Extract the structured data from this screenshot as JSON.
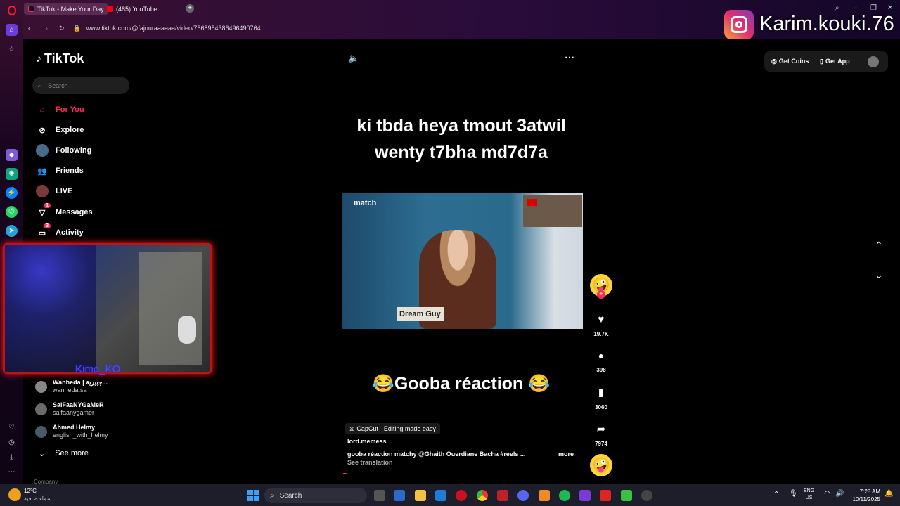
{
  "browser": {
    "tabs": [
      {
        "label": "TikTok - Make Your Day"
      },
      {
        "label": "(485) YouTube"
      }
    ],
    "url": "www.tiktok.com/@fajouraaaaaa/video/7568954386496490764"
  },
  "overlay": {
    "instagram_handle": "Karim.kouki.76",
    "webcam_name": "Kimo_KO"
  },
  "tiktok": {
    "logo": "TikTok",
    "search_placeholder": "Search",
    "nav": [
      {
        "label": "For You",
        "icon": "home-icon",
        "active": true
      },
      {
        "label": "Explore",
        "icon": "compass-icon"
      },
      {
        "label": "Following",
        "icon": "following-avatar"
      },
      {
        "label": "Friends",
        "icon": "friends-icon"
      },
      {
        "label": "LIVE",
        "icon": "live-avatar"
      },
      {
        "label": "Messages",
        "icon": "send-icon",
        "badge": "1"
      },
      {
        "label": "Activity",
        "icon": "chat-icon",
        "badge": "3"
      }
    ],
    "accounts": [
      {
        "name": "Wanheda | جبيرية...",
        "handle": "wanheda.sa"
      },
      {
        "name": "SalFaaNYGaMeR",
        "handle": "saifaanygamer"
      },
      {
        "name": "Ahmed Helmy",
        "handle": "english_with_helmy"
      }
    ],
    "see_more": "See more",
    "company": "Company",
    "header_buttons": {
      "coins": "Get Coins",
      "app": "Get App"
    },
    "video": {
      "caption_top": "ki tbda heya tmout 3atwil wenty t7bha md7d7a",
      "watermark": "match",
      "lower_label": "Dream Guy",
      "caption_bottom": "😂Gooba réaction 😂",
      "capcut": "CapCut · Editing made easy",
      "author": "lord.memess",
      "description": "gooba réaction matchy @Ghaith Ouerdiane Bacha  #reels  ...",
      "more": "more",
      "see_translation": "See translation"
    },
    "actions": {
      "likes": "19.7K",
      "comments": "398",
      "saves": "3060",
      "shares": "7974"
    }
  },
  "taskbar": {
    "weather_temp": "12°C",
    "weather_desc": "سماء صافية",
    "search": "Search",
    "lang1": "ENG",
    "lang2": "US",
    "time": "7:28 AM",
    "date": "10/11/2025"
  },
  "colors": {
    "accent": "#fe2c55",
    "bg": "#000000"
  }
}
